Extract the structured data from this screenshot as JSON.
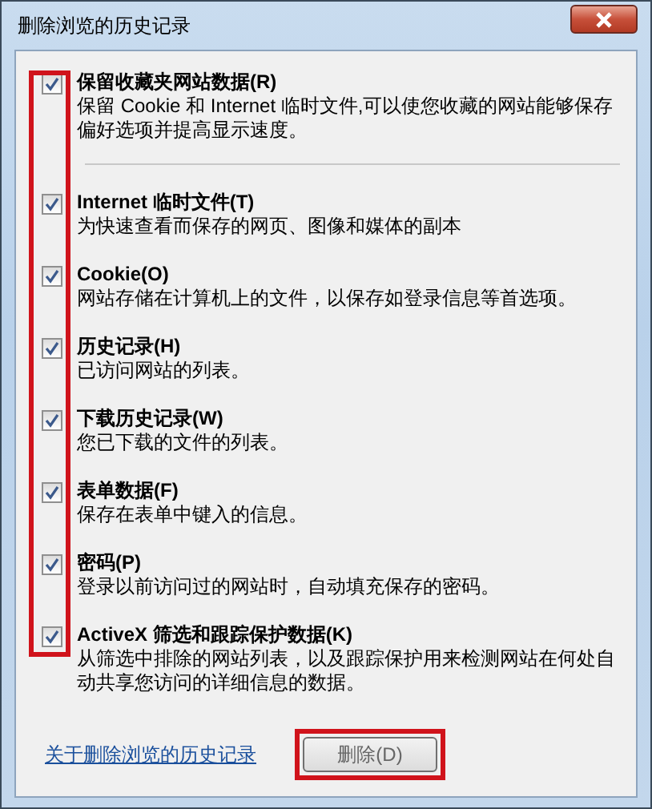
{
  "window": {
    "title": "删除浏览的历史记录"
  },
  "items": [
    {
      "label": "保留收藏夹网站数据(R)",
      "description": "保留 Cookie 和 Internet 临时文件,可以使您收藏的网站能够保存偏好选项并提高显示速度。",
      "checked": true
    },
    {
      "label": "Internet 临时文件(T)",
      "description": "为快速查看而保存的网页、图像和媒体的副本",
      "checked": true
    },
    {
      "label": "Cookie(O)",
      "description": "网站存储在计算机上的文件，以保存如登录信息等首选项。",
      "checked": true
    },
    {
      "label": "历史记录(H)",
      "description": "已访问网站的列表。",
      "checked": true
    },
    {
      "label": "下载历史记录(W)",
      "description": "您已下载的文件的列表。",
      "checked": true
    },
    {
      "label": "表单数据(F)",
      "description": "保存在表单中键入的信息。",
      "checked": true
    },
    {
      "label": "密码(P)",
      "description": "登录以前访问过的网站时，自动填充保存的密码。",
      "checked": true
    },
    {
      "label": "ActiveX 筛选和跟踪保护数据(K)",
      "description": "从筛选中排除的网站列表，以及跟踪保护用来检测网站在何处自动共享您访问的详细信息的数据。",
      "checked": true
    }
  ],
  "footer": {
    "link": "关于删除浏览的历史记录",
    "button": "删除(D)"
  }
}
